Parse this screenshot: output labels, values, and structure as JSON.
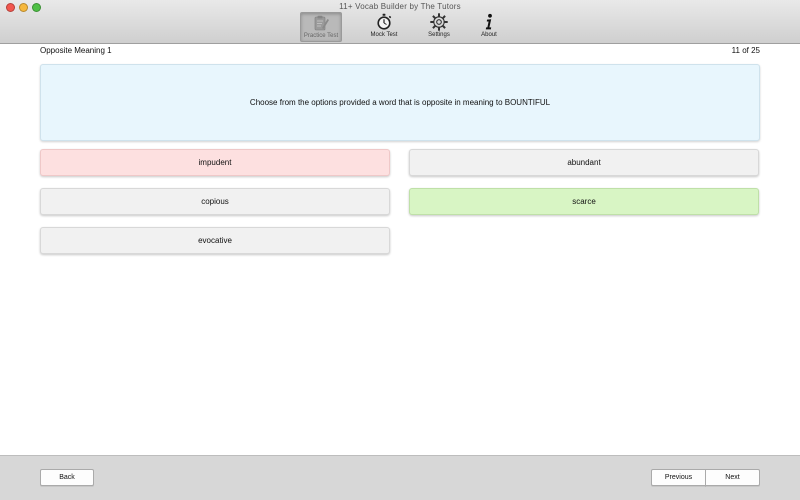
{
  "window": {
    "title": "11+ Vocab Builder by The Tutors"
  },
  "toolbar": {
    "items": [
      {
        "label": "Practice Test",
        "icon": "clipboard-pencil-icon",
        "active": true
      },
      {
        "label": "Mock Test",
        "icon": "stopwatch-icon",
        "active": false
      },
      {
        "label": "Settings",
        "icon": "gear-icon",
        "active": false
      },
      {
        "label": "About",
        "icon": "info-icon",
        "active": false
      }
    ]
  },
  "header": {
    "section_title": "Opposite Meaning 1",
    "counter": "11 of 25"
  },
  "question": {
    "text": "Choose from the options provided a word that is opposite in meaning to BOUNTIFUL"
  },
  "options": [
    {
      "text": "impudent",
      "state": "incorrect"
    },
    {
      "text": "abundant",
      "state": "neutral"
    },
    {
      "text": "copious",
      "state": "neutral"
    },
    {
      "text": "scarce",
      "state": "correct"
    },
    {
      "text": "evocative",
      "state": "neutral"
    }
  ],
  "colors": {
    "question_bg": "#e8f6fd",
    "incorrect_bg": "#fde0e0",
    "correct_bg": "#d8f5c4",
    "neutral_bg": "#f1f1f1"
  },
  "footer": {
    "back_label": "Back",
    "previous_label": "Previous",
    "next_label": "Next"
  }
}
